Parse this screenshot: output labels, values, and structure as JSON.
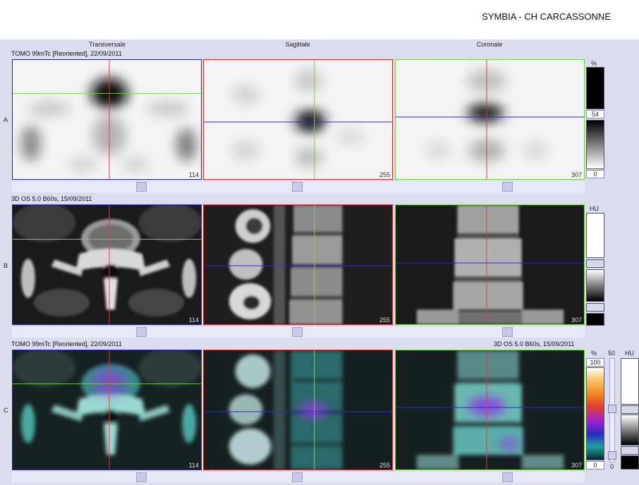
{
  "header": {
    "hospital": "SYMBIA - CH CARCASSONNE"
  },
  "columns": [
    "Transversale",
    "Sagittale",
    "Coronale"
  ],
  "rows": {
    "a": {
      "label": "A",
      "info": "TOMO 99mTc [Reoriented], 22/09/2011"
    },
    "b": {
      "label": "B",
      "info": "3D  OS  5.0  B60s, 15/09/2011"
    },
    "c": {
      "label": "C",
      "info_left": "TOMO 99mTc [Reoriented], 22/09/2011",
      "info_right": "3D  OS  5.0  B60s, 15/09/2011"
    }
  },
  "slices": [
    "114",
    "255",
    "307"
  ],
  "colorbars": {
    "a": {
      "unit": "%",
      "value_mid": "54",
      "value_min": "0"
    },
    "b": {
      "unit": "HU"
    },
    "c": {
      "unit_pct": "%",
      "max_pct": "100",
      "min_pct": "0",
      "slider_val": "50",
      "slider_min": "0",
      "unit_hu": "HU"
    }
  }
}
